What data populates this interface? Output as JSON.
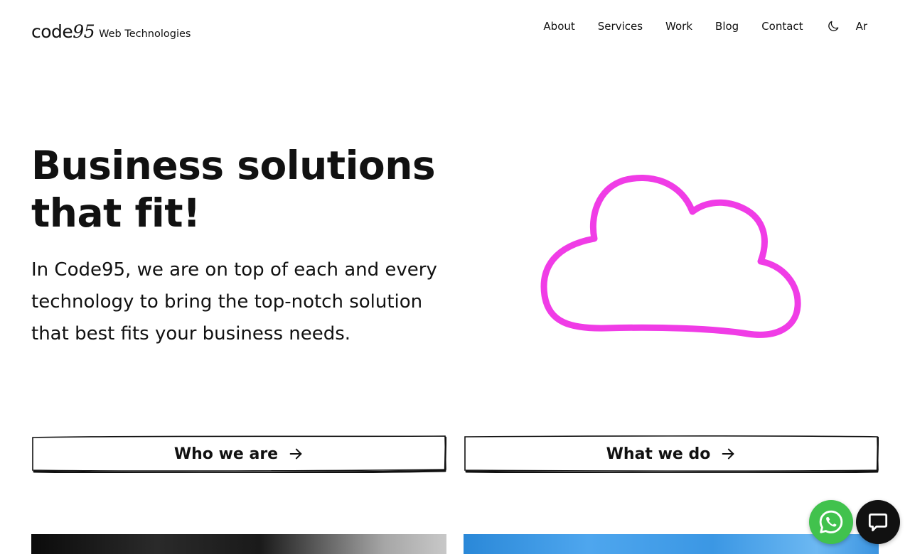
{
  "header": {
    "logo_text": "code",
    "logo_suffix": "95",
    "logo_subtitle": "Web Technologies",
    "nav": [
      {
        "label": "About"
      },
      {
        "label": "Services"
      },
      {
        "label": "Work"
      },
      {
        "label": "Blog"
      },
      {
        "label": "Contact"
      }
    ],
    "theme_toggle_icon": "moon-icon",
    "language_label": "Ar"
  },
  "hero": {
    "title_line1": "Business solutions",
    "title_line2": "that fit!",
    "description": "In Code95, we are on top of each and every technology to bring the top-notch solution that best fits your business needs.",
    "illustration_icon": "cloud-icon",
    "illustration_color": "#f03ce6"
  },
  "buttons": {
    "who_we_are": "Who we are",
    "what_we_do": "What we do",
    "arrow_icon": "arrow-right-icon"
  },
  "floating": {
    "whatsapp_icon": "whatsapp-icon",
    "whatsapp_color": "#41c24d",
    "chat_icon": "chat-icon",
    "chat_color": "#111111"
  }
}
